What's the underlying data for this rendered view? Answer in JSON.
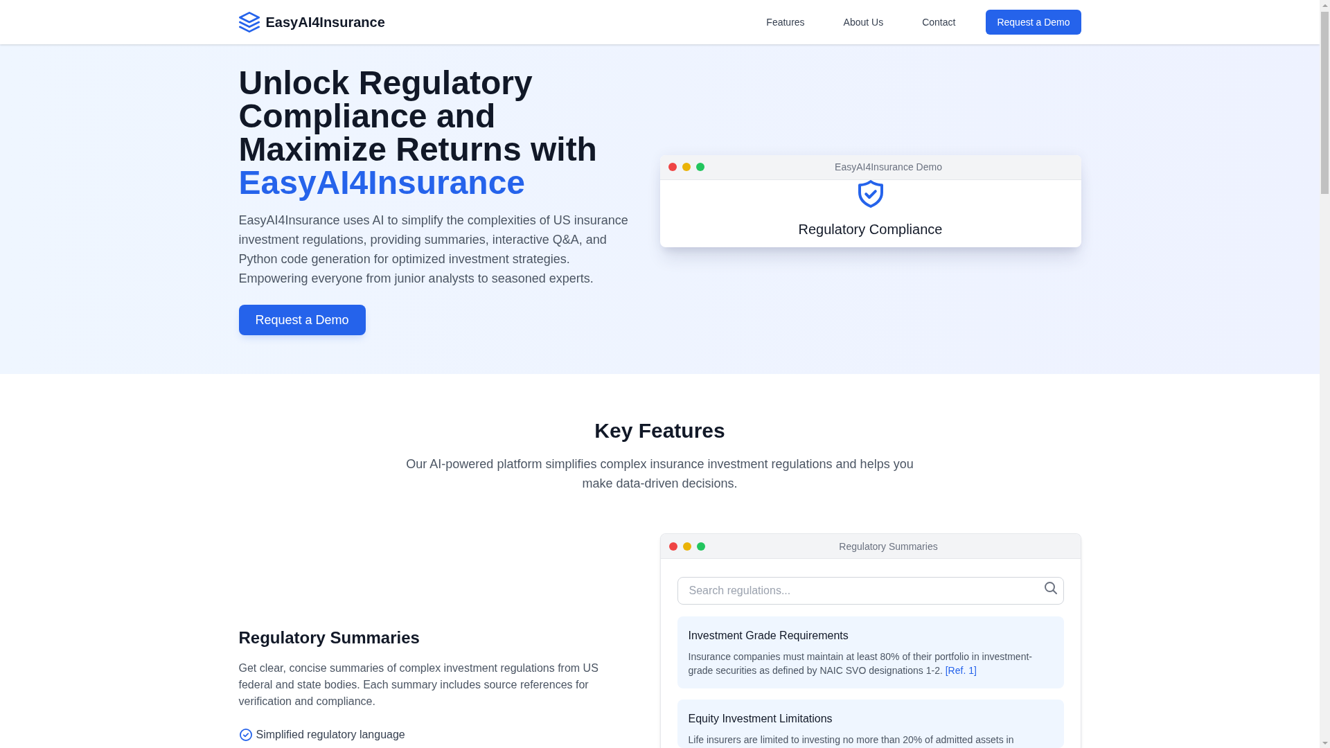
{
  "header": {
    "brand": "EasyAI4Insurance",
    "nav": [
      "Features",
      "About Us",
      "Contact"
    ],
    "button": "Request a Demo"
  },
  "hero": {
    "title": "Unlock Regulatory Compliance and Maximize Returns with",
    "title_highlight": "EasyAI4Insurance",
    "description": "EasyAI4Insurance uses AI to simplify the complexities of US insurance investment regulations, providing summaries, interactive Q&A, and Python code generation for optimized investment strategies. Empowering everyone from junior analysts to seasoned experts.",
    "button": "Request a Demo",
    "demo_window": {
      "title": "EasyAI4Insurance Demo",
      "caption": "Regulatory Compliance"
    }
  },
  "features": {
    "title": "Key Features",
    "subtitle": "Our AI-powered platform simplifies complex insurance investment regulations and helps you make data-driven decisions.",
    "items": [
      {
        "title": "Regulatory Summaries",
        "description": "Get clear, concise summaries of complex investment regulations from US federal and state bodies. Each summary includes source references for verification and compliance.",
        "points": [
          "Simplified regulatory language"
        ],
        "window": {
          "title": "Regulatory Summaries",
          "search": {
            "placeholder": "Search regulations..."
          },
          "cards": [
            {
              "title": "Investment Grade Requirements",
              "text": "Insurance companies must maintain at least 80% of their portfolio in investment-grade securities as defined by NAIC SVO designations 1-2.",
              "ref": "[Ref. 1]"
            },
            {
              "title": "Equity Investment Limitations",
              "text": "Life insurers are limited to investing no more than 20% of admitted assets in"
            }
          ]
        }
      }
    ]
  }
}
